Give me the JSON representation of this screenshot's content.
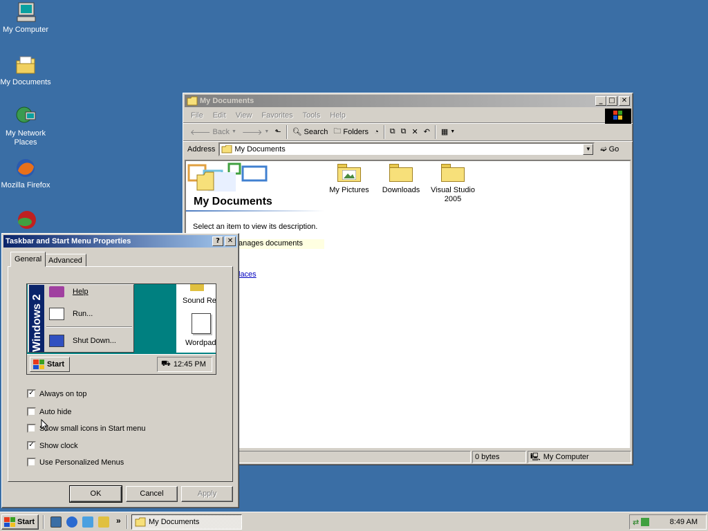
{
  "desktop": {
    "icons": [
      {
        "label": "My Computer",
        "icon": "computer-icon"
      },
      {
        "label": "My Documents",
        "icon": "documents-folder-icon"
      },
      {
        "label_line1": "My Network",
        "label_line2": "Places",
        "icon": "network-icon"
      },
      {
        "label": "Mozilla Firefox",
        "icon": "firefox-icon"
      },
      {
        "label": "",
        "icon": "app-icon"
      }
    ]
  },
  "explorer": {
    "title": "My Documents",
    "menu": [
      "File",
      "Edit",
      "View",
      "Favorites",
      "Tools",
      "Help"
    ],
    "toolbar": {
      "back": "Back",
      "search": "Search",
      "folders": "Folders"
    },
    "address_label": "Address",
    "address_value": "My Documents",
    "go": "Go",
    "panel_title": "My Documents",
    "panel_hint": "Select an item to view its description.",
    "panel_desc": "anages documents",
    "panel_link": "laces",
    "items": [
      {
        "label": "My Pictures",
        "icon": "pictures-folder-icon"
      },
      {
        "label": "Downloads",
        "icon": "folder-icon"
      },
      {
        "label_line1": "Visual Studio",
        "label_line2": "2005",
        "icon": "folder-icon"
      }
    ],
    "status": {
      "size": "0 bytes",
      "location": "My Computer"
    }
  },
  "dialog": {
    "title": "Taskbar and Start Menu Properties",
    "tabs": [
      "General",
      "Advanced"
    ],
    "preview": {
      "brand": "Windows 2",
      "menu": [
        "Help",
        "Run...",
        "Shut Down..."
      ],
      "right_items": [
        "Sound Re",
        "Wordpad"
      ],
      "start": "Start",
      "clock": "12:45 PM"
    },
    "options": [
      {
        "label": "Always on top",
        "checked": true
      },
      {
        "label": "Auto hide",
        "checked": false
      },
      {
        "label": "Show small icons in Start menu",
        "checked": false
      },
      {
        "label": "Show clock",
        "checked": true
      },
      {
        "label": "Use Personalized Menus",
        "checked": false
      }
    ],
    "buttons": {
      "ok": "OK",
      "cancel": "Cancel",
      "apply": "Apply"
    }
  },
  "taskbar": {
    "start": "Start",
    "chevron": "»",
    "task": "My Documents",
    "clock": "8:49 AM"
  },
  "colors": {
    "desktop": "#3a6ea5",
    "title_active": "#0a246a",
    "title_inactive": "#808080",
    "face": "#d4d0c8"
  }
}
